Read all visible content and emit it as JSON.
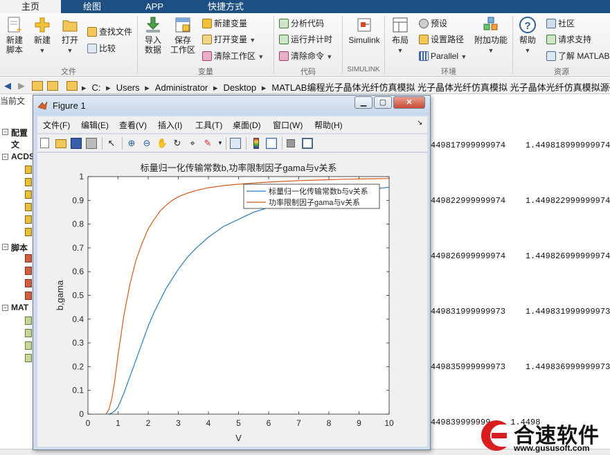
{
  "ribbon_tabs": [
    "主页",
    "绘图",
    "APP",
    "快捷方式"
  ],
  "ribbon": {
    "file": {
      "group": "文件",
      "new_script": "新建\n脚本",
      "new": "新建",
      "open": "打开",
      "find_files": "查找文件",
      "compare": "比较"
    },
    "variable": {
      "group": "变量",
      "import_data": "导入\n数据",
      "save_workspace": "保存\n工作区",
      "new_variable": "新建变量",
      "open_variable": "打开变量",
      "clear_workspace": "清除工作区"
    },
    "code": {
      "group": "代码",
      "analyze_code": "分析代码",
      "run_time": "运行并计时",
      "clear_commands": "清除命令"
    },
    "simulink": {
      "group": "SIMULINK",
      "simulink": "Simulink"
    },
    "environment": {
      "group": "环境",
      "layout": "布局",
      "preferences": "预设",
      "set_path": "设置路径",
      "parallel": "Parallel",
      "addons": "附加功能"
    },
    "resources": {
      "group": "资源",
      "help": "帮助",
      "community": "社区",
      "request_support": "请求支持",
      "learn_matlab": "了解 MATLAB"
    }
  },
  "address": {
    "crumbs": [
      "C:",
      "Users",
      "Administrator",
      "Desktop",
      "MATLAB编程光子晶体光纤仿真模拟 光子晶体光纤仿真模拟 光子晶体光纤仿真模拟源码程序"
    ]
  },
  "background": {
    "current_folder": "当前文",
    "sections": [
      "配置文",
      "ACDS",
      "脚本",
      "MAT"
    ],
    "rows": [
      {
        "a": "449817999999974",
        "b": "1.449818999999974"
      },
      {
        "a": "449822999999974",
        "b": "1.449822999999974"
      },
      {
        "a": "449826999999974",
        "b": "1.449826999999974"
      },
      {
        "a": "449831999999973",
        "b": "1.449831999999973"
      },
      {
        "a": "449835999999973",
        "b": "1.449836999999973"
      },
      {
        "a": "449839999999",
        "b": "1.4498"
      }
    ]
  },
  "figure": {
    "window_title": "Figure 1",
    "menus": [
      "文件(F)",
      "编辑(E)",
      "查看(V)",
      "插入(I)",
      "工具(T)",
      "桌面(D)",
      "窗口(W)",
      "帮助(H)"
    ]
  },
  "chart_data": {
    "type": "line",
    "title": "标量归一化传输常数b,功率限制因子gama与v关系",
    "xlabel": "V",
    "ylabel": "b,gama",
    "xlim": [
      0,
      10
    ],
    "ylim": [
      0,
      1
    ],
    "xticks": [
      0,
      1,
      2,
      3,
      4,
      5,
      6,
      7,
      8,
      9,
      10
    ],
    "yticks": [
      0,
      0.1,
      0.2,
      0.3,
      0.4,
      0.5,
      0.6,
      0.7,
      0.8,
      0.9,
      1
    ],
    "grid": false,
    "legend_position": "top-right",
    "series": [
      {
        "name": "标量归一化传输常数b与v关系",
        "color": "#2a7ab8",
        "x": [
          0.6,
          0.7,
          0.8,
          0.9,
          1.0,
          1.2,
          1.4,
          1.6,
          1.8,
          2.0,
          2.2,
          2.4,
          2.6,
          2.8,
          3.0,
          3.3,
          3.6,
          4.0,
          4.5,
          5.0,
          5.5,
          6.0,
          6.5,
          7.0,
          7.5,
          8.0,
          8.5,
          9.0,
          9.5,
          10.0
        ],
        "y": [
          0.0,
          0.001,
          0.005,
          0.015,
          0.03,
          0.09,
          0.16,
          0.23,
          0.3,
          0.37,
          0.43,
          0.48,
          0.53,
          0.57,
          0.61,
          0.66,
          0.7,
          0.745,
          0.79,
          0.82,
          0.85,
          0.87,
          0.89,
          0.905,
          0.915,
          0.925,
          0.935,
          0.94,
          0.948,
          0.955
        ]
      },
      {
        "name": "功率限制因子gama与v关系",
        "color": "#d45a1c",
        "x": [
          0.6,
          0.7,
          0.8,
          0.9,
          1.0,
          1.2,
          1.4,
          1.6,
          1.8,
          2.0,
          2.2,
          2.4,
          2.6,
          2.8,
          3.0,
          3.3,
          3.6,
          4.0,
          4.5,
          5.0,
          5.5,
          6.0,
          6.5,
          7.0,
          7.5,
          8.0,
          8.5,
          9.0,
          9.5,
          10.0
        ],
        "y": [
          0.0,
          0.02,
          0.07,
          0.15,
          0.25,
          0.42,
          0.55,
          0.65,
          0.72,
          0.78,
          0.82,
          0.855,
          0.88,
          0.9,
          0.915,
          0.93,
          0.942,
          0.953,
          0.962,
          0.968,
          0.973,
          0.977,
          0.98,
          0.983,
          0.985,
          0.987,
          0.989,
          0.99,
          0.991,
          0.992
        ]
      }
    ]
  },
  "watermark": {
    "name": "合速软件",
    "url": "www.gususoft.com"
  }
}
